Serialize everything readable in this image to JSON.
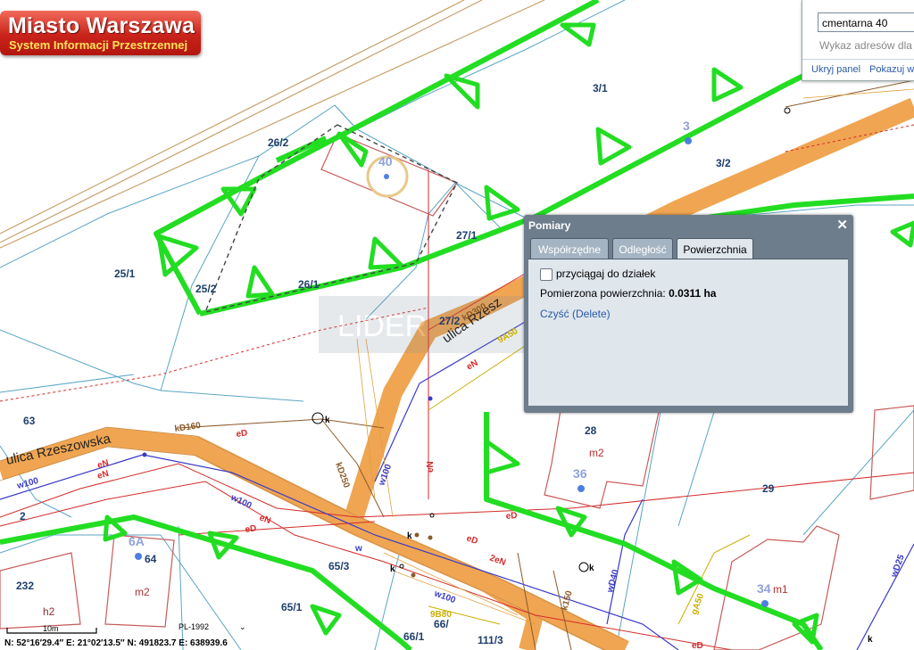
{
  "header": {
    "logo_title": "Miasto Warszawa",
    "logo_subtitle": "System Informacji Przestrzennej"
  },
  "search": {
    "value": "cmentarna 40",
    "hint": "Wykaz adresów dla",
    "hide_panel_link": "Ukryj panel",
    "show_link": "Pokazuj w"
  },
  "measure_panel": {
    "title": "Pomiary",
    "close_symbol": "✕",
    "tabs": [
      "Współrzędne",
      "Odległość",
      "Powierzchnia"
    ],
    "active_tab": "Powierzchnia",
    "snap_checkbox_label": "przyciągaj do działek",
    "snap_checked": false,
    "area_label": "Pomierzona powierzchnia:",
    "area_value": "0.0311 ha",
    "clear_link": "Czyść (Delete)"
  },
  "map": {
    "street_names": [
      "ulica Rzeszowska",
      "ulica Rzesz"
    ],
    "parcel_labels": [
      "3/1",
      "3/2",
      "26/2",
      "25/1",
      "25/2",
      "26/1",
      "27/1",
      "27/2",
      "63",
      "28",
      "29",
      "232",
      "65/1",
      "65/3",
      "66/1",
      "66/",
      "111/3",
      "2"
    ],
    "address_numbers": [
      "40",
      "3",
      "36",
      "6A",
      "64",
      "34"
    ],
    "building_labels": [
      "m2",
      "m2",
      "m1",
      "h2"
    ],
    "utility_labels": [
      "kD160",
      "kD250",
      "w100",
      "w100",
      "w100",
      "w100",
      "eN",
      "eN",
      "eN",
      "eN",
      "eD",
      "eD",
      "eD",
      "eD",
      "2eN",
      "k",
      "k",
      "k",
      "k",
      "w",
      "wD40",
      "wD25",
      "9A50",
      "gA50",
      "gA50",
      "k150",
      "kD300",
      "9B80",
      "eN",
      "eD",
      "k"
    ],
    "watermark": "LIDER"
  },
  "status": {
    "coordinates": "N: 52°16′29.4″  E: 21°02′13.5″  N: 491823.7   E: 638939.6",
    "scale_label": "10m",
    "crs": "PL-1992",
    "crs_dropdown": "⌄"
  },
  "colors": {
    "road": "#f0a552",
    "zone_border": "#22dd22",
    "parcel_line": "#5aa6c4",
    "building": "#c85a5a",
    "measure_polygon": "#444444",
    "panel_frame": "#6e7d8c"
  }
}
